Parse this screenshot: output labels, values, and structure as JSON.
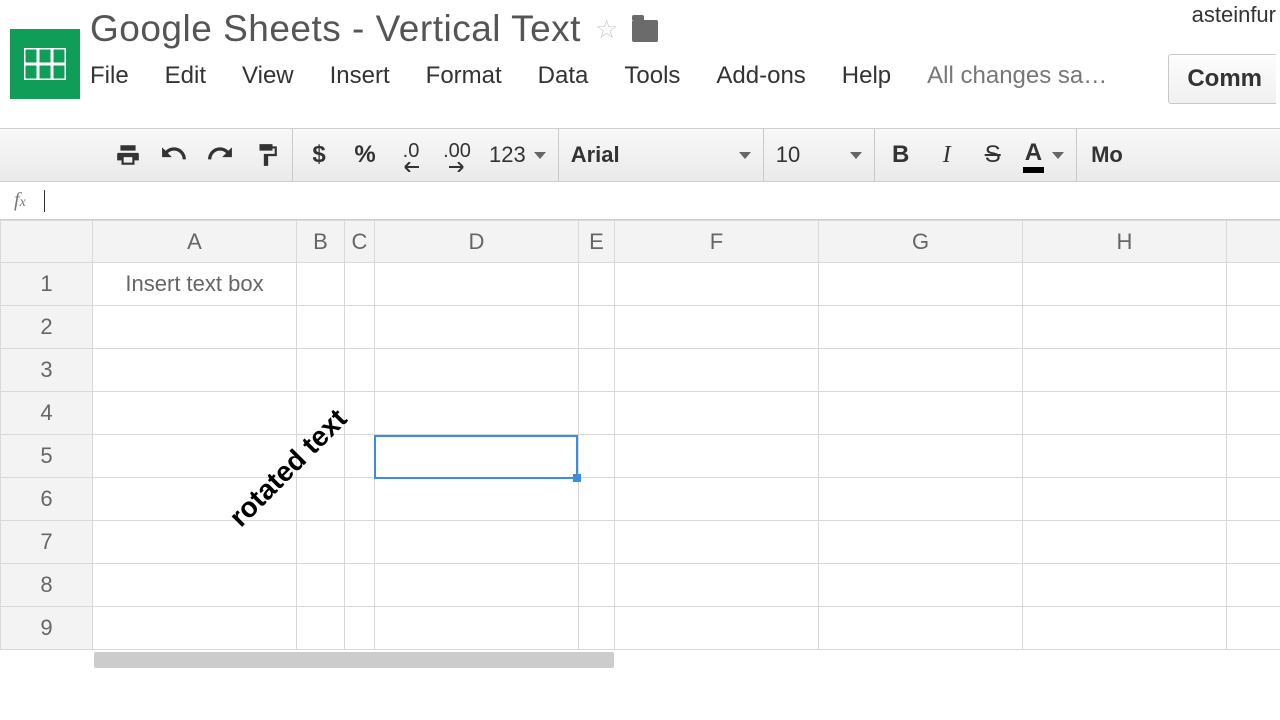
{
  "app": {
    "name": "Google Sheets"
  },
  "doc": {
    "title": "Google Sheets - Vertical Text"
  },
  "user": {
    "name": "asteinfur"
  },
  "header": {
    "star_tooltip": "Star",
    "folder_tooltip": "Move to folder",
    "comments_label": "Comm"
  },
  "menu": {
    "items": [
      "File",
      "Edit",
      "View",
      "Insert",
      "Format",
      "Data",
      "Tools",
      "Add-ons",
      "Help"
    ],
    "save_status": "All changes sa…"
  },
  "toolbar": {
    "currency": "$",
    "percent": "%",
    "dec_minus": ".0",
    "dec_plus": ".00",
    "numfmt": "123",
    "font": "Arial",
    "font_size": "10",
    "bold": "B",
    "italic": "I",
    "strike": "S",
    "text_color": "A",
    "more": "Mo"
  },
  "formula": {
    "label": "fx",
    "value": ""
  },
  "grid": {
    "columns": [
      "A",
      "B",
      "C",
      "D",
      "E",
      "F",
      "G",
      "H",
      ""
    ],
    "rows": [
      "1",
      "2",
      "3",
      "4",
      "5",
      "6",
      "7",
      "8",
      "9"
    ],
    "selected": {
      "col": "D",
      "row": "5"
    },
    "cells": {
      "A1": {
        "text": "Insert text box",
        "color": "#cc0000",
        "bold": true
      }
    },
    "drawing": {
      "text": "rotated text",
      "rotation_deg": -45
    }
  }
}
